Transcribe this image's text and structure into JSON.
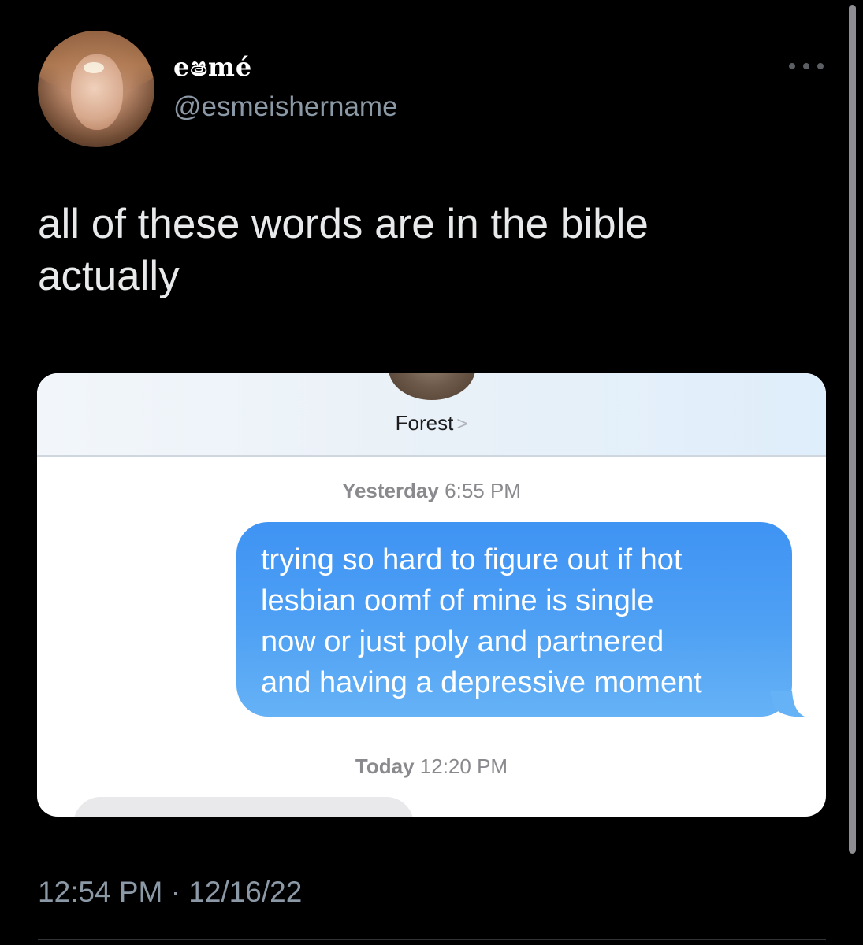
{
  "tweet": {
    "display_name": "eෂmé",
    "handle": "@esmeishername",
    "text_lines": [
      "all of these words are in the bible",
      "actually"
    ],
    "timestamp": "12:54 PM · 12/16/22"
  },
  "screenshot": {
    "contact_name": "Forest",
    "contact_chevron": ">",
    "timestamp_1_day": "Yesterday",
    "timestamp_1_time": "6:55 PM",
    "message_lines": [
      "trying so hard to figure out if hot",
      "lesbian oomf of mine is single",
      "now or just poly and partnered",
      "and having a depressive moment"
    ],
    "timestamp_2_day": "Today",
    "timestamp_2_time": "12:20 PM"
  },
  "icons": {
    "more": "more-horizontal-icon",
    "chevron": "chevron-right-icon"
  },
  "colors": {
    "background": "#000000",
    "secondary_text": "#8b98a5",
    "imessage_blue": "#4fa1f4"
  }
}
